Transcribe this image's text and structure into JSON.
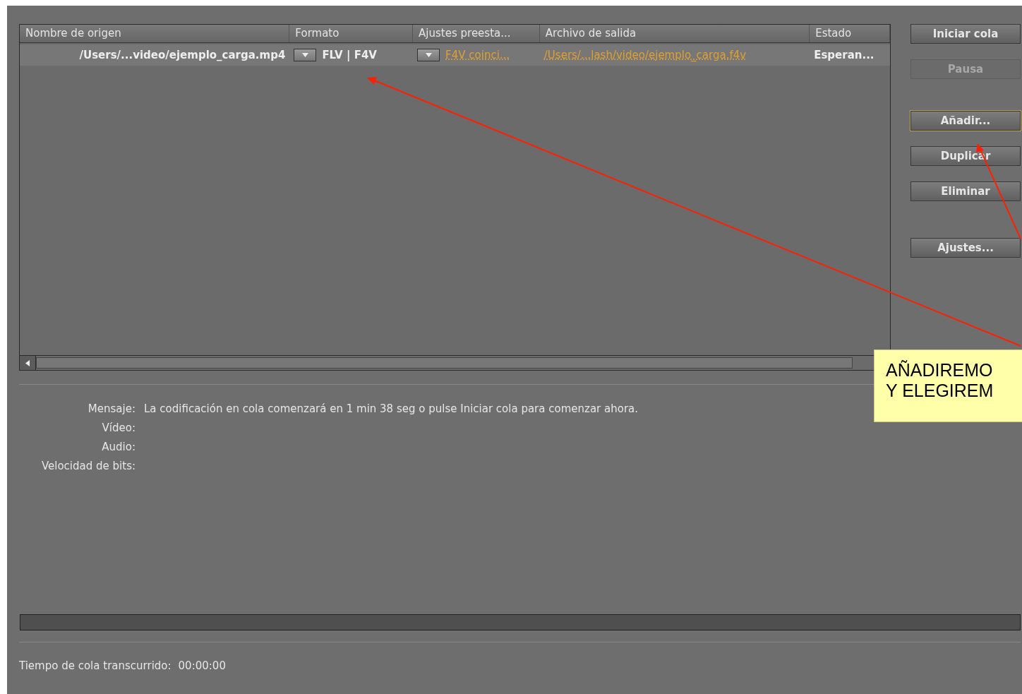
{
  "queue": {
    "columns": [
      "Nombre de origen",
      "Formato",
      "Ajustes preesta...",
      "Archivo de salida",
      "Estado"
    ],
    "rows": [
      {
        "source": "/Users/...video/ejemplo_carga.mp4",
        "format": "FLV | F4V",
        "preset": "F4V coinci...",
        "output": "/Users/...lash/video/ejemplo_carga.f4v",
        "status": "Esperan...",
        "selected": true
      }
    ]
  },
  "buttons": [
    {
      "label": "Iniciar cola",
      "disabled": false,
      "focused": false
    },
    {
      "label": "Pausa",
      "disabled": true,
      "focused": false
    },
    {
      "label": "Añadir...",
      "disabled": false,
      "focused": true
    },
    {
      "label": "Duplicar",
      "disabled": false,
      "focused": false
    },
    {
      "label": "Eliminar",
      "disabled": false,
      "focused": false
    },
    {
      "label": "Ajustes...",
      "disabled": false,
      "focused": false
    }
  ],
  "info": [
    {
      "label": "Mensaje:",
      "value": "La codificación en cola comenzará en 1 min 38 seg o pulse Iniciar cola para comenzar ahora."
    },
    {
      "label": "Vídeo:"
    },
    {
      "label": "Audio:"
    },
    {
      "label": "Velocidad de bits:"
    }
  ],
  "progress": {
    "level": 0
  },
  "elapsed": {
    "label": "Tiempo de cola transcurrido:",
    "value": "00:00:00"
  },
  "callout": {
    "lines": [
      "AÑADIREMO",
      "Y ELEGIREM"
    ]
  }
}
